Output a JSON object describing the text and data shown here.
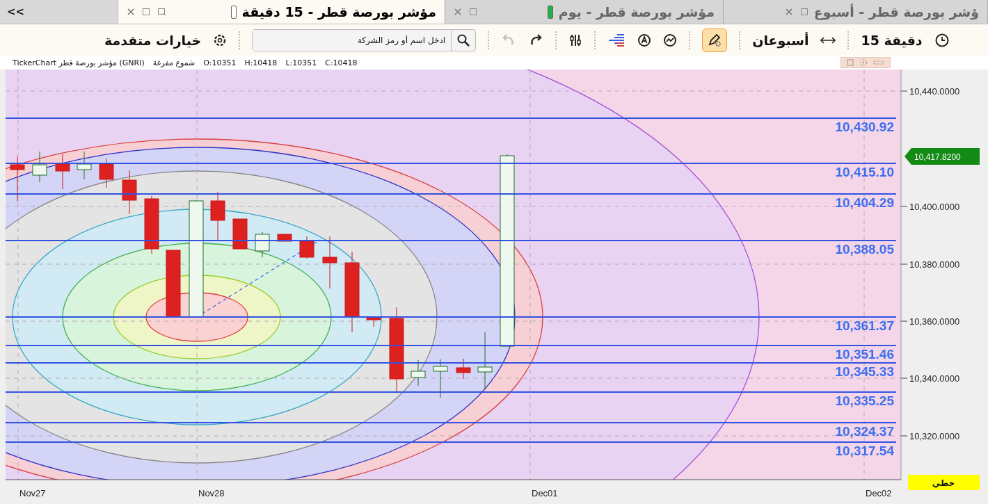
{
  "tabs_overflow": {
    "label": "<<"
  },
  "tabs": [
    {
      "title": "ؤشر بورصة قطر - أسبوع",
      "selected": false
    },
    {
      "title": "مؤشر بورصة قطر - يوم",
      "selected": false,
      "color": "#22b04a"
    },
    {
      "title": "مؤشر بورصة قطر - 15 دقيقة",
      "selected": true,
      "color": "#ffffff"
    }
  ],
  "toolbar": {
    "advanced": "خيارات متقدمة",
    "search": {
      "placeholder": "ادخل اسم أو رمز الشركة"
    },
    "undo_disabled": true,
    "drawing_tool_active": true,
    "range": "أسبوعان",
    "interval": "15 دقيقة"
  },
  "info": {
    "title": "TickerChart مؤشر بورصة قطر (GNRI)",
    "chart_type": "شموع مفرغة",
    "ohlc": [
      "O:10351",
      "H:10418",
      "L:10351",
      "C:10418"
    ]
  },
  "levels": [
    "10,430.92",
    "10,415.10",
    "10,404.29",
    "10,388.05",
    "10,361.37",
    "10,351.46",
    "10,345.33",
    "10,335.25",
    "10,324.37",
    "10,317.54"
  ],
  "y_ticks": [
    "10,440.0000",
    "10,400.0000",
    "10,380.0000",
    "10,360.0000",
    "10,340.0000",
    "10,320.0000"
  ],
  "last_price": "10,417.8200",
  "x_ticks": [
    "Nov27",
    "Nov28",
    "Dec01",
    "Dec02"
  ],
  "scale_mode": "خطي"
}
